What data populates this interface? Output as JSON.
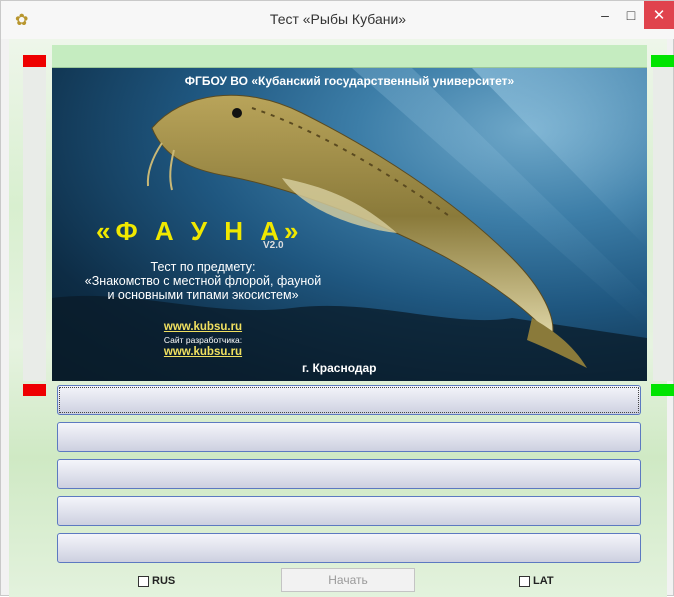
{
  "window": {
    "title": "Тест «Рыбы Кубани»",
    "minimize_glyph": "–",
    "maximize_glyph": "□",
    "close_glyph": "✕",
    "app_icon": "fish-app-icon"
  },
  "banner": {
    "university": "ФГБОУ ВО «Кубанский государственный университет»",
    "program_title": "«Ф А У Н А»",
    "version": "V2.0",
    "subject_line1": "Тест по предмету:",
    "subject_line2": "«Знакомство с местной флорой, фауной",
    "subject_line3": "и основными типами экосистем»",
    "site_link": "www.kubsu.ru",
    "developer_label": "Сайт разработчика:",
    "developer_link": "www.kubsu.ru",
    "city": "г. Краснодар"
  },
  "answers": [
    "",
    "",
    "",
    "",
    ""
  ],
  "controls": {
    "rus_label": "RUS",
    "lat_label": "LAT",
    "start_label": "Начать",
    "rus_checked": false,
    "lat_checked": false,
    "start_enabled": false
  },
  "colors": {
    "close_button": "#e0434d",
    "marker_red": "#ee0000",
    "marker_green": "#00e400",
    "title_yellow": "#f0e800",
    "answer_border": "#5c79c1"
  }
}
